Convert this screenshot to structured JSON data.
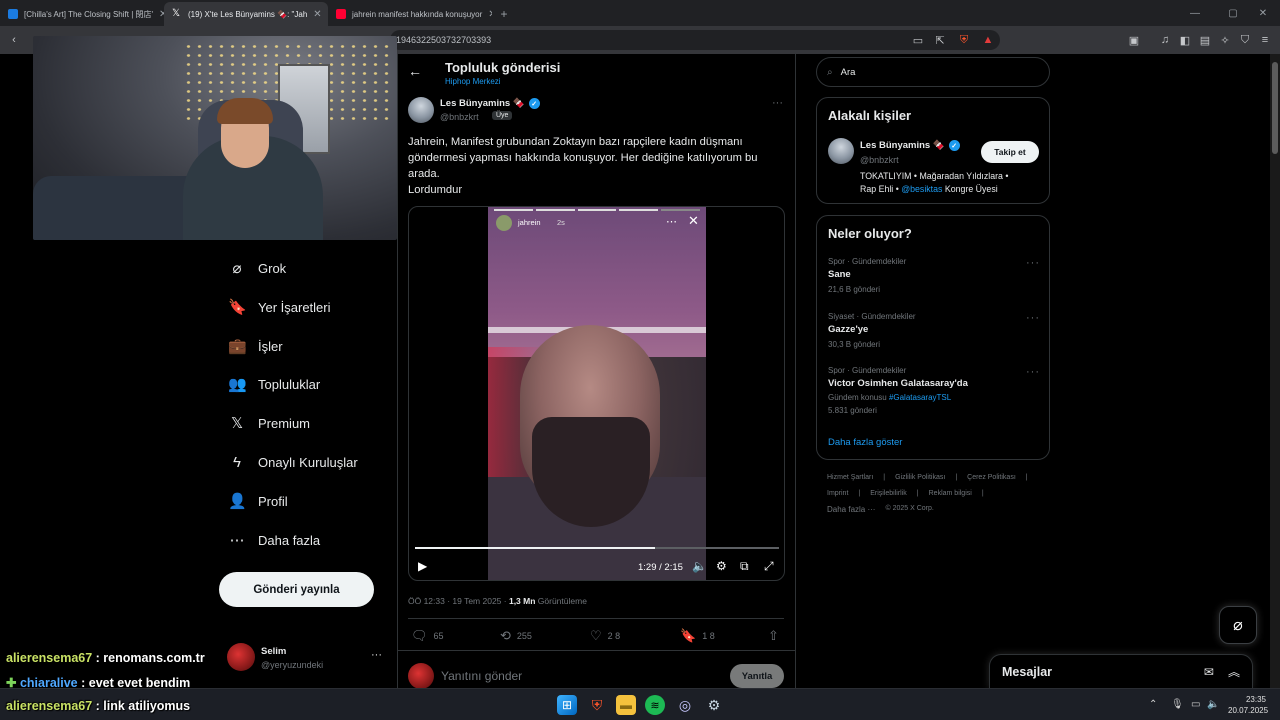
{
  "browser": {
    "tabs": [
      {
        "title": "[Chilla's Art] The Closing Shift | 閉店'",
        "favicon_color": "#1b7be0",
        "active": false
      },
      {
        "title": "(19) X'te Les Bünyamins 🍫: \"Jah",
        "favicon_color": "#ffffff",
        "active": true
      },
      {
        "title": "jahrein manifest hakkında konuşuyor",
        "favicon_color": "#ff0033",
        "active": false
      }
    ],
    "new_tab": "+",
    "url_fragment": "1946322503732703393",
    "colors": {
      "frame": "#202124",
      "toolbar": "#35363a"
    }
  },
  "left_nav": {
    "items": [
      {
        "label": "Grok",
        "icon": "grok-icon",
        "glyph": "⌀"
      },
      {
        "label": "Yer İşaretleri",
        "icon": "bookmark-icon",
        "glyph": "🔖"
      },
      {
        "label": "İşler",
        "icon": "briefcase-icon",
        "glyph": "💼"
      },
      {
        "label": "Topluluklar",
        "icon": "communities-icon",
        "glyph": "👥"
      },
      {
        "label": "Premium",
        "icon": "x-logo-icon",
        "glyph": "𝕏"
      },
      {
        "label": "Onaylı Kuruluşlar",
        "icon": "lightning-icon",
        "glyph": "ϟ"
      },
      {
        "label": "Profil",
        "icon": "profile-icon",
        "glyph": "👤"
      },
      {
        "label": "Daha fazla",
        "icon": "more-circle-icon",
        "glyph": "⋯"
      }
    ],
    "post_button": "Gönderi yayınla",
    "account": {
      "name": "Selim",
      "handle": "@yeryuzundeki",
      "more": "···"
    }
  },
  "post": {
    "header_title": "Topluluk gönderisi",
    "header_subtitle": "Hiphop Merkezi",
    "author_name": "Les Bünyamins 🍫",
    "author_handle": "@bnbzkrt",
    "member_badge": "Üye",
    "more": "···",
    "text_lines": [
      "Jahrein, Manifest grubundan Zoktayın bazı rapçilere kadın düşmanı",
      "göndermesi yapması hakkında konuşuyor. Her dediğine katılıyorum bu",
      "arada.",
      "Lordumdur"
    ],
    "video": {
      "story_user": "jahrein",
      "story_age": "2s",
      "time": "1:29 / 2:15",
      "progress": 0.659
    },
    "timestamp": "ÖÖ 12:33 · 19 Tem 2025 · ",
    "views_count": "1,3 Mn",
    "views_label": " Görüntüleme",
    "actions": [
      {
        "icon": "reply-icon",
        "glyph": "🗨",
        "count": "65"
      },
      {
        "icon": "repost-icon",
        "glyph": "⟲",
        "count": "255"
      },
      {
        "icon": "like-icon",
        "glyph": "♡",
        "count": "2 8"
      },
      {
        "icon": "bookmark-icon",
        "glyph": "🔖",
        "count": "1 8"
      },
      {
        "icon": "share-icon",
        "glyph": "⇧",
        "count": ""
      }
    ],
    "reply_placeholder": "Yanıtını gönder",
    "reply_button": "Yanıtla"
  },
  "right": {
    "search_placeholder": "Ara",
    "relevant_title": "Alakalı kişiler",
    "relevant_person": {
      "name": "Les Bünyamins 🍫",
      "handle": "@bnbzkrt",
      "follow": "Takip et",
      "bio_part1": "TOKATLIYIM • Mağaradan Yıldızlara •",
      "bio_part2": "Rap Ehli • ",
      "bio_link": "@besiktas",
      "bio_part3": " Kongre Üyesi"
    },
    "trends_title": "Neler oluyor?",
    "trends": [
      {
        "meta": "Spor · Gündemdekiler",
        "name": "Sane",
        "extra": "",
        "extra_tag": "",
        "count": "21,6 B gönderi"
      },
      {
        "meta": "Siyaset · Gündemdekiler",
        "name": "Gazze'ye",
        "extra": "",
        "extra_tag": "",
        "count": "30,3 B gönderi"
      },
      {
        "meta": "Spor · Gündemdekiler",
        "name": "Victor Osimhen Galatasaray'da",
        "extra": "Gündem konusu ",
        "extra_tag": "#GalatasarayTSL",
        "count": "5.831 gönderi"
      }
    ],
    "show_more": "Daha fazla göster",
    "footer_row1": [
      "Hizmet Şartları",
      "|",
      "Gizlilik Politikası",
      "|",
      "Çerez Politikası",
      "|"
    ],
    "footer_row2": [
      "Imprint",
      "|",
      "Erişilebilirlik",
      "|",
      "Reklam bilgisi",
      "|"
    ],
    "footer_row3": [
      "Daha fazla ···",
      "© 2025 X Corp."
    ],
    "messages": "Mesajlar"
  },
  "chat": [
    {
      "user": "alierensema67",
      "user_color": "#c9e265",
      "message": " : renomans.com.tr",
      "prefix": ""
    },
    {
      "user": "chiaralive",
      "user_color": "#4fa8ff",
      "message": " : evet evet bendim",
      "prefix": "✚ "
    },
    {
      "user": "alierensema67",
      "user_color": "#c9e265",
      "message": " : link atiliyomus",
      "prefix": ""
    }
  ],
  "taskbar": {
    "clock_time": "23:35",
    "clock_date": "20.07.2025"
  }
}
